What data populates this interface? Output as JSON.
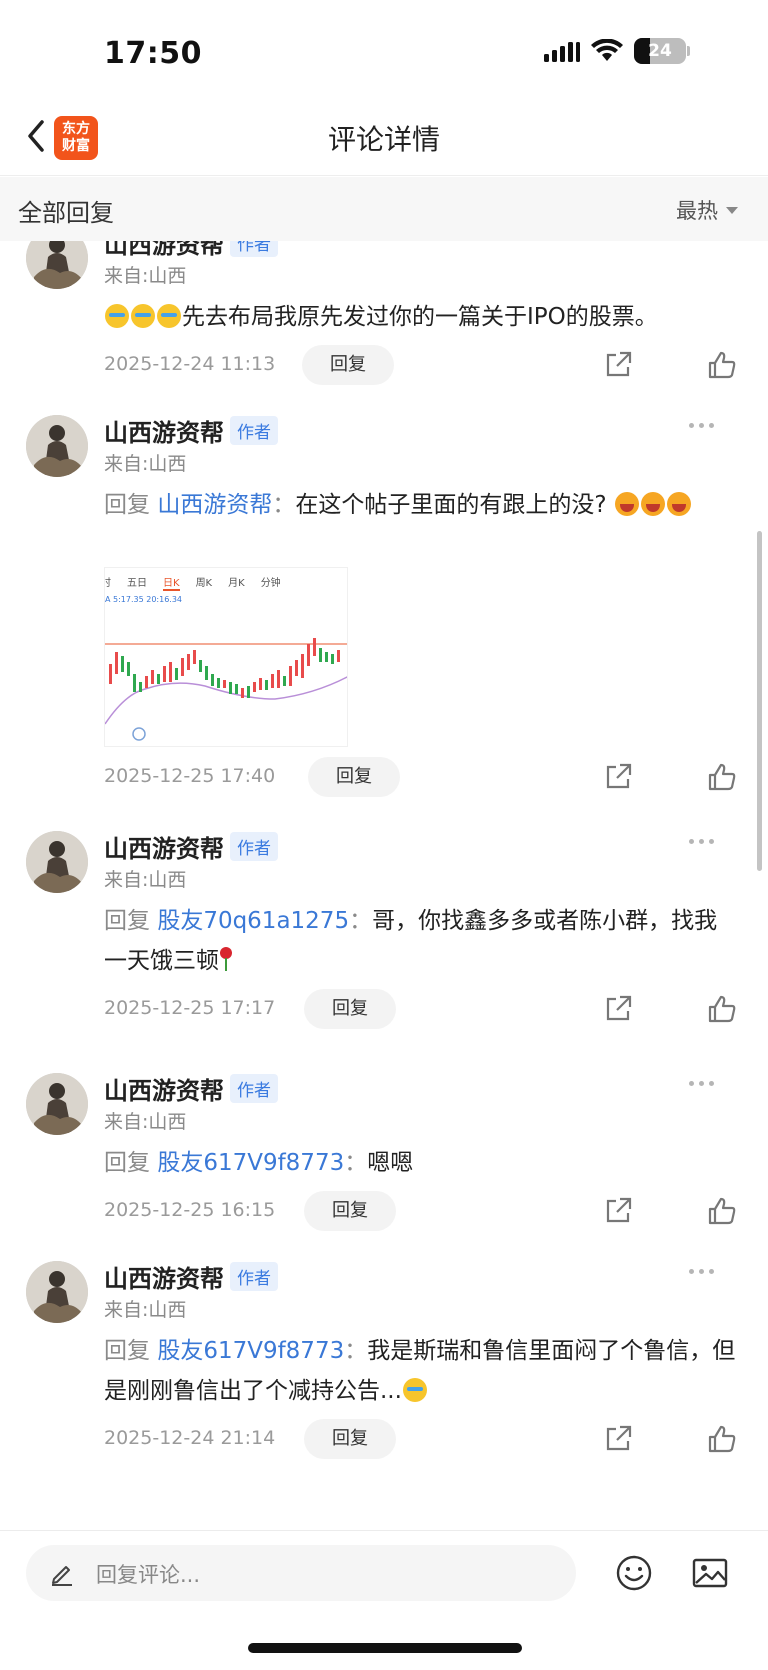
{
  "status_bar": {
    "time": "17:50",
    "battery_level": "24",
    "icons": [
      "signal-icon",
      "wifi-icon",
      "battery-icon"
    ]
  },
  "nav": {
    "title": "评论详情",
    "logo_text_line1": "东方",
    "logo_text_line2": "财富",
    "icons": [
      "back-icon"
    ]
  },
  "section": {
    "title": "全部回复",
    "sort_label": "最热"
  },
  "comments": [
    {
      "author": "山西游资帮",
      "badge": "作者",
      "location": "来自:山西",
      "text": "先去布局我原先发过你的一篇关于IPO的股票。",
      "timestamp": "2025-12-24 11:13",
      "reply_label": "回复"
    },
    {
      "author": "山西游资帮",
      "badge": "作者",
      "location": "来自:山西",
      "reply_prefix": "回复",
      "reply_target": "山西游资帮",
      "colon": "：",
      "text": "在这个帖子里面的有跟上的没?",
      "timestamp": "2025-12-25 17:40",
      "reply_label": "回复",
      "image_tabs": [
        "时",
        "五日",
        "日K",
        "周K",
        "月K",
        "分钟"
      ],
      "image_info": "A 5:17.35  20:16.34"
    },
    {
      "author": "山西游资帮",
      "badge": "作者",
      "location": "来自:山西",
      "reply_prefix": "回复",
      "reply_target": "股友70q61a1275",
      "colon": "：",
      "text": "哥，你找鑫多多或者陈小群，找我一天饿三顿",
      "timestamp": "2025-12-25 17:17",
      "reply_label": "回复"
    },
    {
      "author": "山西游资帮",
      "badge": "作者",
      "location": "来自:山西",
      "reply_prefix": "回复",
      "reply_target": "股友617V9f8773",
      "colon": "：",
      "text": "嗯嗯",
      "timestamp": "2025-12-25 16:15",
      "reply_label": "回复"
    },
    {
      "author": "山西游资帮",
      "badge": "作者",
      "location": "来自:山西",
      "reply_prefix": "回复",
      "reply_target": "股友617V9f8773",
      "colon": "：",
      "text": "我是斯瑞和鲁信里面闷了个鲁信，但是刚刚鲁信出了个减持公告...",
      "timestamp": "2025-12-24 21:14",
      "reply_label": "回复"
    }
  ],
  "input_bar": {
    "placeholder": "回复评论...",
    "icons": [
      "edit-icon",
      "emoji-icon",
      "image-icon"
    ]
  },
  "colors": {
    "accent": "#3a78d6",
    "brand": "#f2541b",
    "muted": "#8a8a8a"
  }
}
